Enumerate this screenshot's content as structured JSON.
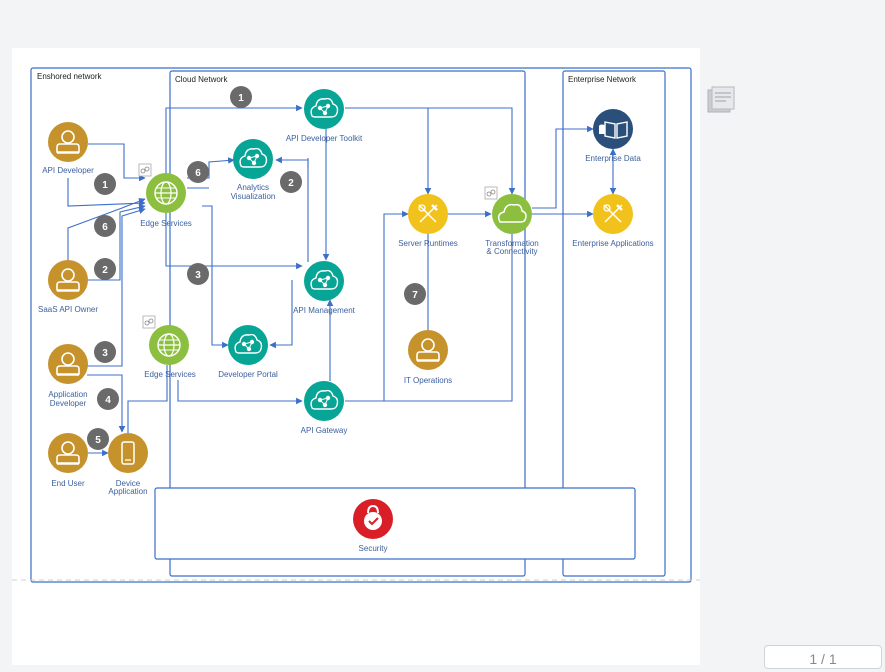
{
  "zones": {
    "onshore": "Enshored network",
    "cloud": "Cloud Network",
    "enterprise": "Enterprise Network"
  },
  "nodes": {
    "api_developer": "API Developer",
    "saas_api_owner": "SaaS API Owner",
    "application_developer": [
      "Application",
      "Developer"
    ],
    "end_user": "End User",
    "device_application": [
      "Device",
      "Application"
    ],
    "edge_services_top": "Edge Services",
    "edge_services_bottom": "Edge Services",
    "api_developer_toolkit": "API Developer Toolkit",
    "analytics_visualization": [
      "Analytics",
      "Visualization"
    ],
    "api_management": "API Management",
    "developer_portal": "Developer Portal",
    "api_gateway": "API Gateway",
    "server_runtimes": "Server Runtimes",
    "transformation_connectivity": [
      "Transformation",
      "& Connectivity"
    ],
    "it_operations": "IT Operations",
    "enterprise_data": "Enterprise Data",
    "enterprise_applications": "Enterprise Applications",
    "security": "Security"
  },
  "steps": [
    "1",
    "2",
    "3",
    "4",
    "5",
    "6",
    "7"
  ],
  "colors": {
    "user": "#c5922c",
    "teal": "#06a595",
    "green": "#8cbf3f",
    "yellow": "#f1c21b",
    "navy": "#2a4f7a",
    "red": "#da1e28",
    "badge": "#6a6a6a",
    "flow": "#3c6fc9"
  },
  "icons": [
    "person-icon",
    "globe-icon",
    "cloud-network-icon",
    "mobile-icon",
    "tools-icon",
    "cloud-icon",
    "book-icon",
    "lock-icon",
    "link-icon",
    "note-icon"
  ],
  "pager": "1 / 1"
}
